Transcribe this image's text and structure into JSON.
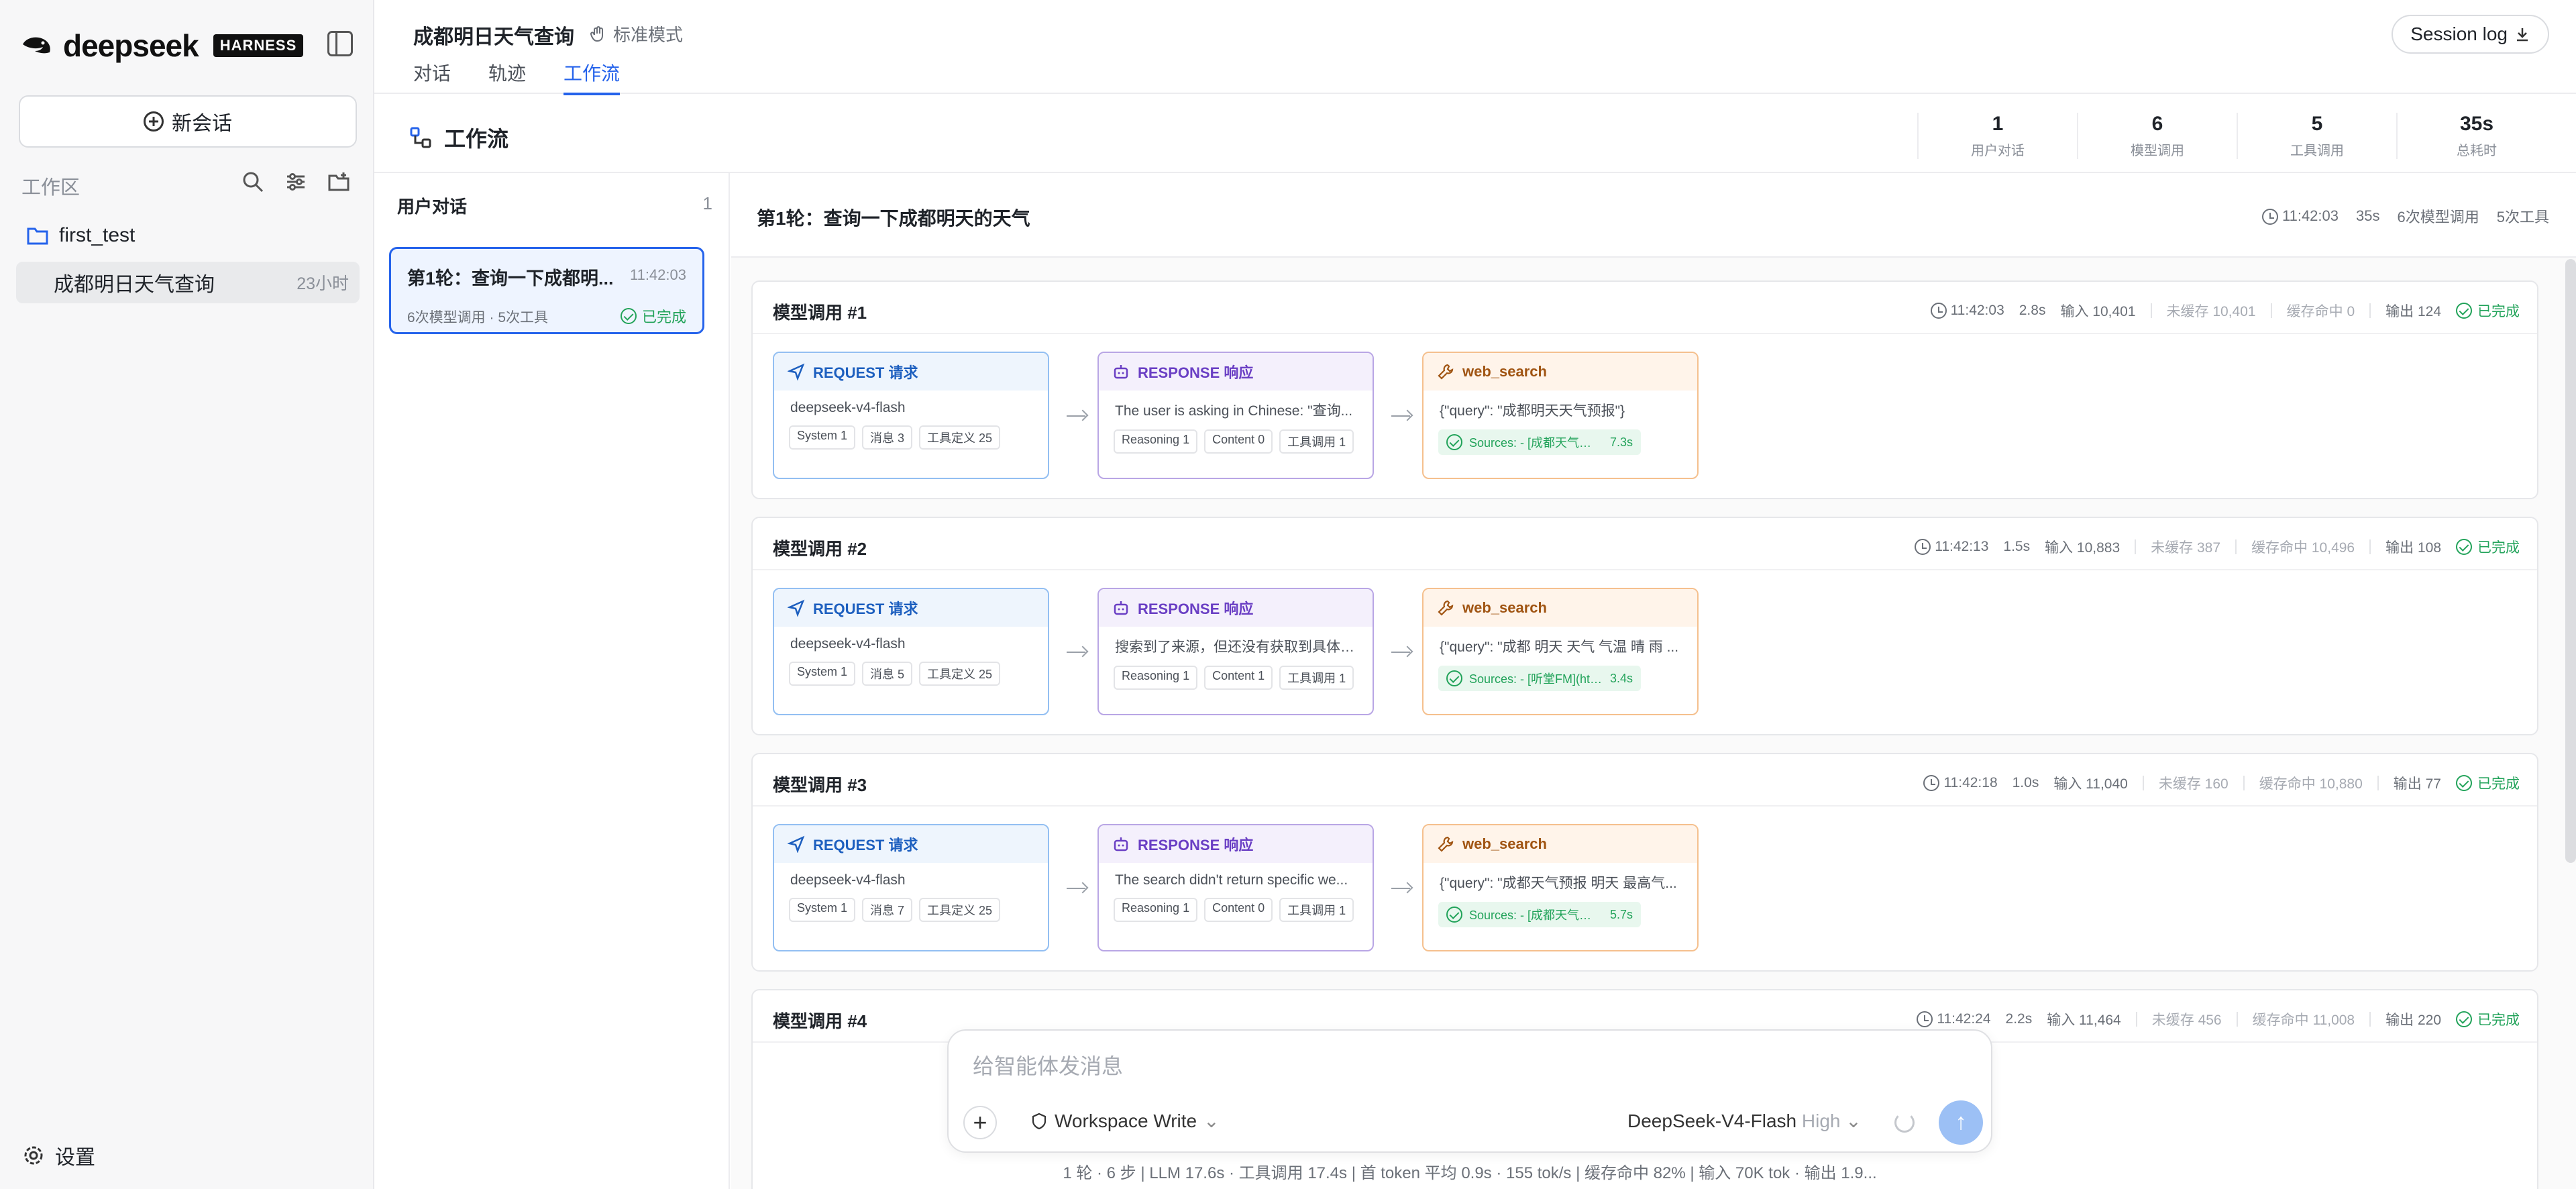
{
  "brand": {
    "name": "deepseek",
    "badge": "HARNESS"
  },
  "sidebar": {
    "new_chat": "新会话",
    "workspace_label": "工作区",
    "folder": "first_test",
    "session_title": "成都明日天气查询",
    "session_age": "23小时",
    "settings": "设置"
  },
  "header": {
    "title": "成都明日天气查询",
    "mode": "标准模式",
    "tabs": [
      "对话",
      "轨迹",
      "工作流"
    ],
    "session_log": "Session log"
  },
  "workflow": {
    "title": "工作流",
    "stats": [
      {
        "value": "1",
        "label": "用户对话"
      },
      {
        "value": "6",
        "label": "模型调用"
      },
      {
        "value": "5",
        "label": "工具调用"
      },
      {
        "value": "35s",
        "label": "总耗时"
      }
    ]
  },
  "list": {
    "header": "用户对话",
    "count": "1",
    "turn": {
      "title": "第1轮：查询一下成都明...",
      "time": "11:42:03",
      "sub": "6次模型调用 · 5次工具",
      "status": "已完成"
    }
  },
  "turn": {
    "title": "第1轮：查询一下成都明天的天气",
    "time": "11:42:03",
    "duration": "35s",
    "model_calls": "6次模型调用",
    "tool_calls": "5次工具"
  },
  "calls": [
    {
      "name": "模型调用 #1",
      "time": "11:42:03",
      "dur": "2.8s",
      "input": "输入 10,401",
      "uncached": "未缓存 10,401",
      "hit": "缓存命中 0",
      "output": "输出 124",
      "status": "已完成",
      "req": {
        "label": "REQUEST 请求",
        "model": "deepseek-v4-flash",
        "tags": [
          "System 1",
          "消息 3",
          "工具定义 25"
        ]
      },
      "resp": {
        "label": "RESPONSE 响应",
        "text": "The user is asking in Chinese: \"查询...",
        "tags": [
          "Reasoning 1",
          "Content 0",
          "工具调用 1"
        ]
      },
      "tool": {
        "label": "web_search",
        "query": "{\"query\": \"成都明天天气预报\"}",
        "src": "Sources: - [成都天气预报,成...",
        "t": "7.3s"
      }
    },
    {
      "name": "模型调用 #2",
      "time": "11:42:13",
      "dur": "1.5s",
      "input": "输入 10,883",
      "uncached": "未缓存 387",
      "hit": "缓存命中 10,496",
      "output": "输出 108",
      "status": "已完成",
      "req": {
        "label": "REQUEST 请求",
        "model": "deepseek-v4-flash",
        "tags": [
          "System 1",
          "消息 5",
          "工具定义 25"
        ]
      },
      "resp": {
        "label": "RESPONSE 响应",
        "text": "搜索到了来源，但还没有获取到具体的...",
        "tags": [
          "Reasoning 1",
          "Content 1",
          "工具调用 1"
        ]
      },
      "tool": {
        "label": "web_search",
        "query": "{\"query\": \"成都 明天 天气 气温 晴 雨 ...",
        "src": "Sources: - [听堂FM](https:/...",
        "t": "3.4s"
      }
    },
    {
      "name": "模型调用 #3",
      "time": "11:42:18",
      "dur": "1.0s",
      "input": "输入 11,040",
      "uncached": "未缓存 160",
      "hit": "缓存命中 10,880",
      "output": "输出 77",
      "status": "已完成",
      "req": {
        "label": "REQUEST 请求",
        "model": "deepseek-v4-flash",
        "tags": [
          "System 1",
          "消息 7",
          "工具定义 25"
        ]
      },
      "resp": {
        "label": "RESPONSE 响应",
        "text": "The search didn't return specific we...",
        "tags": [
          "Reasoning 1",
          "Content 0",
          "工具调用 1"
        ]
      },
      "tool": {
        "label": "web_search",
        "query": "{\"query\": \"成都天气预报 明天 最高气...",
        "src": "Sources: - [成都天气预报,成...",
        "t": "5.7s"
      }
    },
    {
      "name": "模型调用 #4",
      "time": "11:42:24",
      "dur": "2.2s",
      "input": "输入 11,464",
      "uncached": "未缓存 456",
      "hit": "缓存命中 11,008",
      "output": "输出 220",
      "status": "已完成"
    }
  ],
  "composer": {
    "placeholder": "给智能体发消息",
    "workspace": "Workspace Write",
    "model": "DeepSeek-V4-Flash",
    "effort": "High"
  },
  "footer": "1 轮 · 6 步  |  LLM 17.6s · 工具调用 17.4s  |  首 token 平均 0.9s · 155 tok/s  |  缓存命中 82%  |  输入 70K tok · 输出 1.9..."
}
